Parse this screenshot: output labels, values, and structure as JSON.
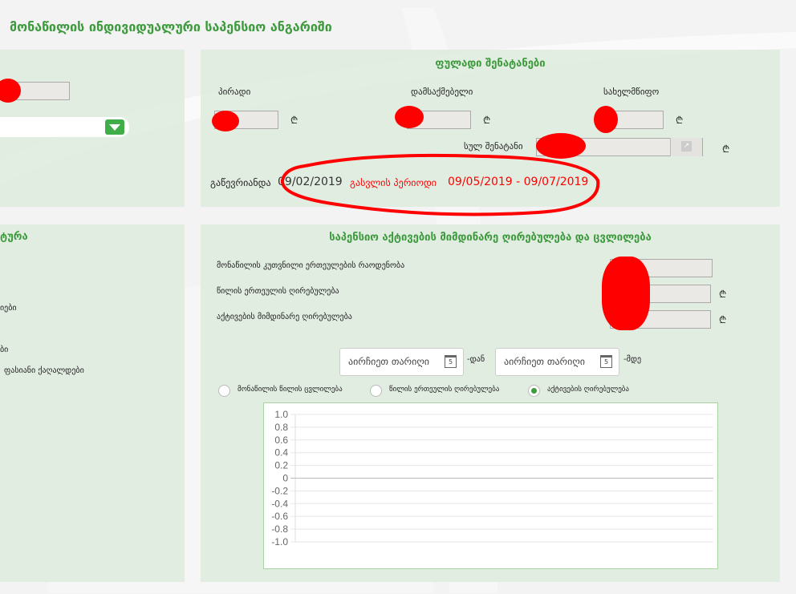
{
  "page_title": "მონაწილის ინდივიდუალური საპენსიო ანგარიში",
  "contributions": {
    "title": "ფულადი შენატანები",
    "personal_label": "პირადი",
    "employer_label": "დამსაქმებელი",
    "state_label": "სახელმწიფო",
    "total_label": "სულ შენატანი",
    "currency_symbol": "₾",
    "registered_label": "გაწევრიანდა",
    "registered_date": "09/02/2019",
    "exit_period_label": "გასვლის პერიოდი",
    "exit_period_range": "09/05/2019 - 09/07/2019"
  },
  "left_panel": {
    "title_fragment": "ტურა",
    "items": [
      "იები",
      "ბი",
      "ფასიანი ქაღალდები"
    ]
  },
  "assets": {
    "title": "საპენსიო აქტივების მიმდინარე ღირებულება და ცვლილება",
    "fields": [
      {
        "label": "მონაწილის კუთვნილი ერთეულების რაოდენობა"
      },
      {
        "label": "წილის ერთეულის ღირებულება"
      },
      {
        "label": "აქტივების მიმდინარე ღირებულება"
      }
    ],
    "date_from_placeholder": "აირჩიეთ თარიღი",
    "date_to_placeholder": "აირჩიეთ თარიღი",
    "from_suffix": "-დან",
    "to_suffix": "-მდე",
    "calendar_day": "5",
    "radios": [
      {
        "label": "მონაწილის წილის ცვლილება",
        "checked": false
      },
      {
        "label": "წილის ერთეულის ღირებულება",
        "checked": false
      },
      {
        "label": "აქტივების ღირებულება",
        "checked": true
      }
    ]
  },
  "chart_data": {
    "type": "line",
    "title": "",
    "series": [],
    "ylim": [
      -1.0,
      1.0
    ],
    "yticks": [
      "1.0",
      "0.8",
      "0.6",
      "0.4",
      "0.2",
      "0",
      "-0.2",
      "-0.4",
      "-0.6",
      "-0.8",
      "-1.0"
    ],
    "grid": true
  },
  "colors": {
    "accent": "#3d9a3d",
    "alert": "#ff0000"
  }
}
